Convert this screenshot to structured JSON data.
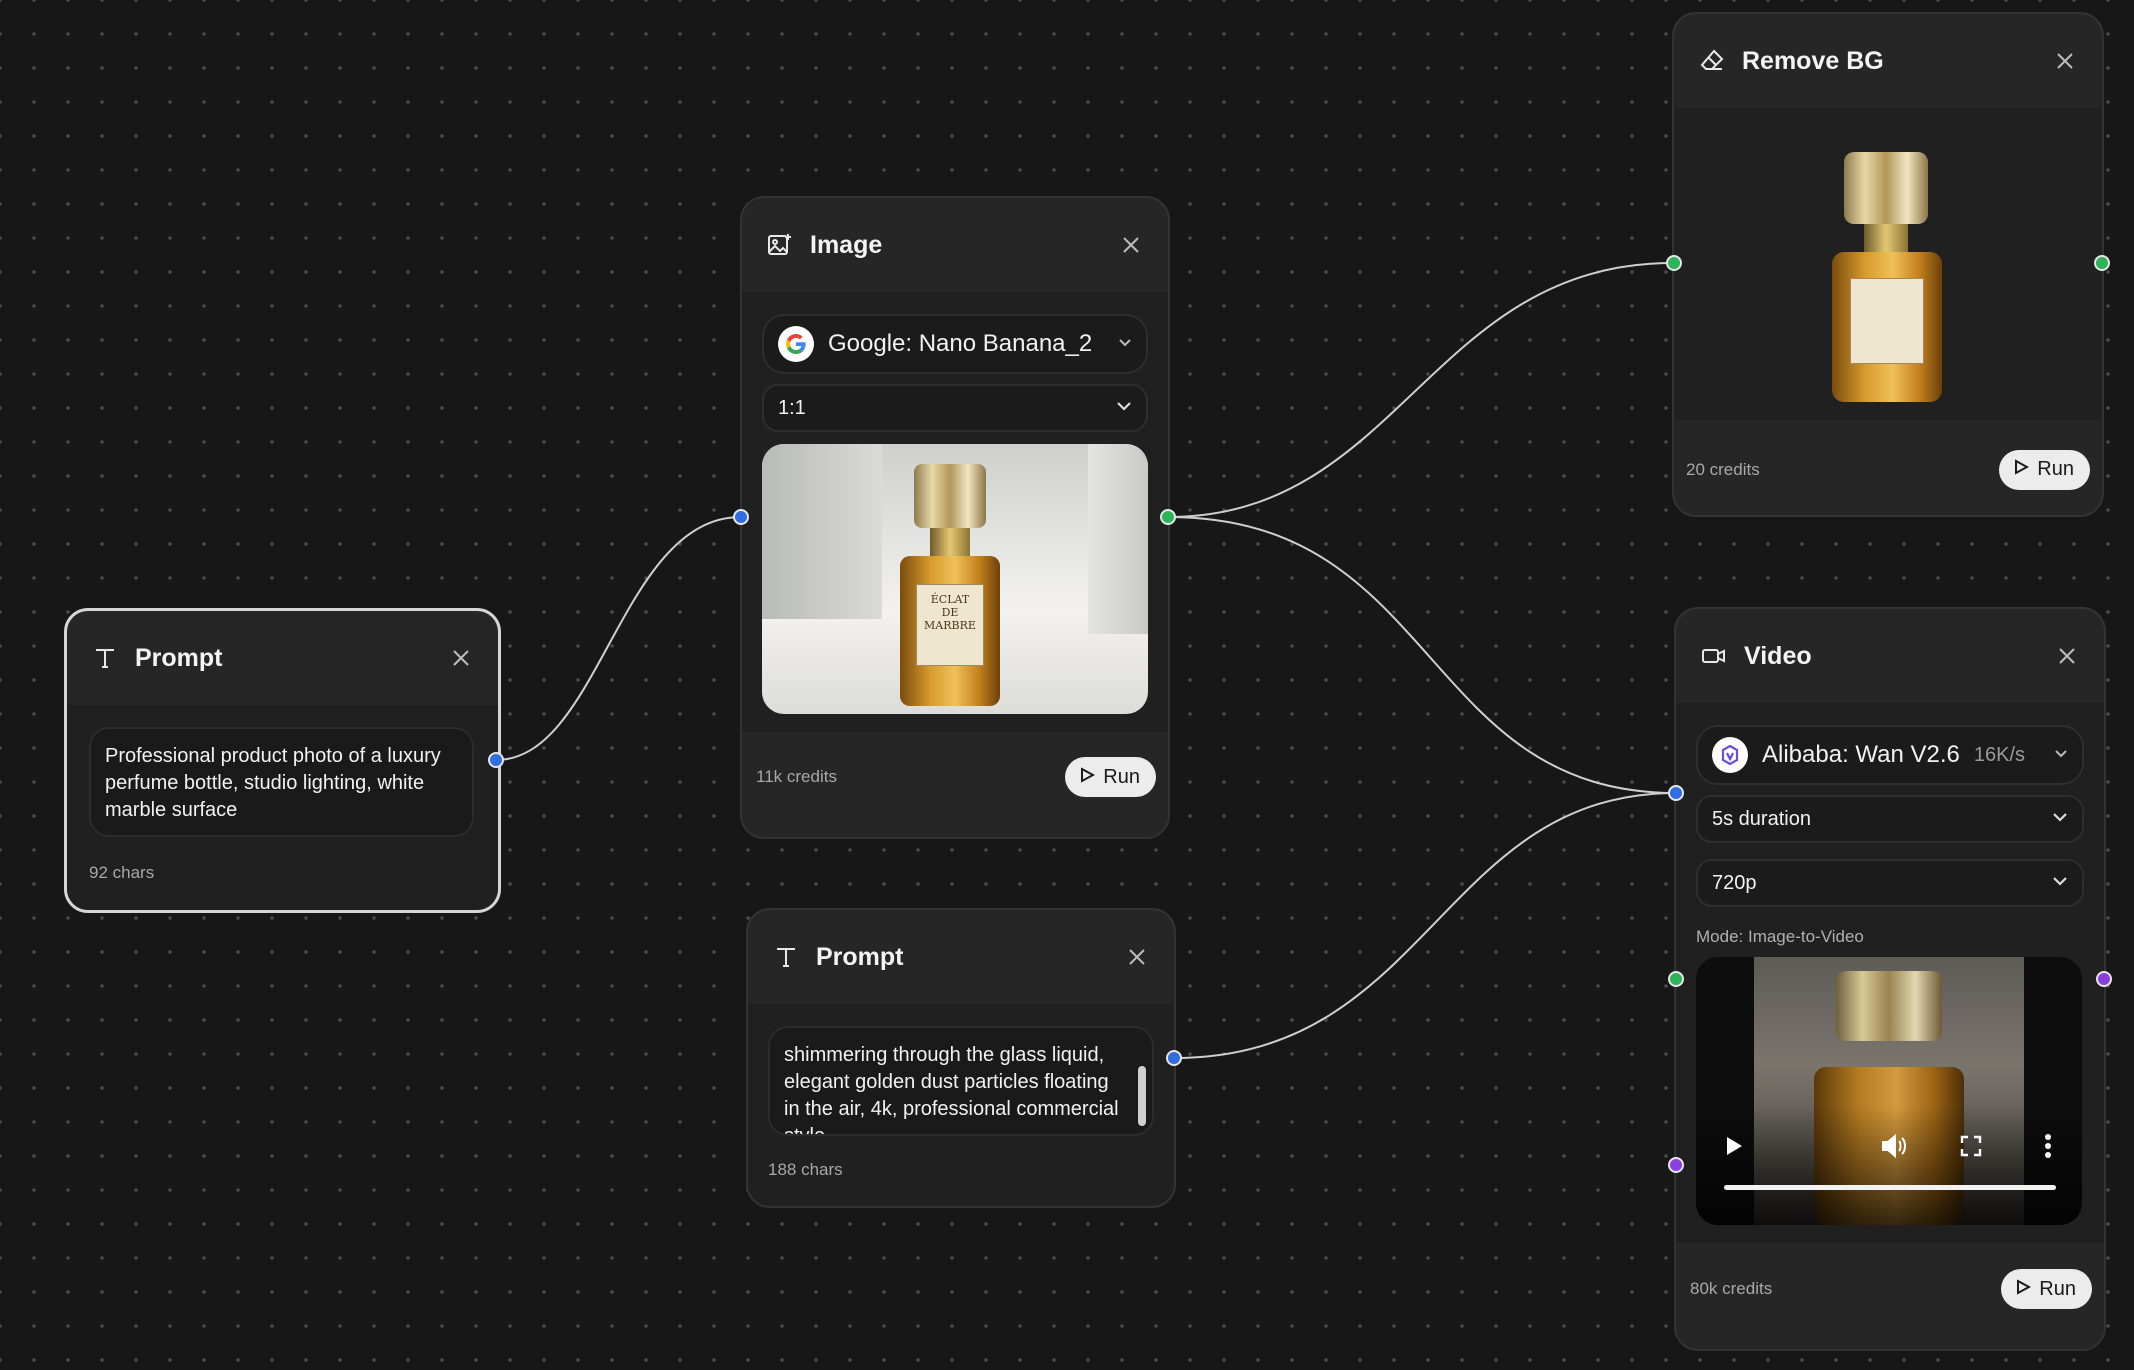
{
  "canvas": {
    "prompt_node_1": {
      "title": "Prompt",
      "text": "Professional product photo of a luxury perfume bottle, studio lighting, white marble surface",
      "chars": "92 chars"
    },
    "image_node": {
      "title": "Image",
      "model": "Google: Nano Banana_2",
      "aspect_ratio": "1:1",
      "credits": "11k credits",
      "run_label": "Run",
      "image_label": "ÉCLAT\nDE\nMARBRE"
    },
    "prompt_node_2": {
      "title": "Prompt",
      "text": "shimmering through the glass liquid, elegant golden dust particles floating in the air, 4k, professional commercial style",
      "chars": "188 chars"
    },
    "remove_bg_node": {
      "title": "Remove BG",
      "credits": "20 credits",
      "run_label": "Run"
    },
    "video_node": {
      "title": "Video",
      "model": "Alibaba: Wan V2.6",
      "model_price": "16K/s",
      "duration": "5s duration",
      "resolution": "720p",
      "mode": "Mode: Image-to-Video",
      "credits": "80k credits",
      "run_label": "Run",
      "progress": 1.0
    }
  },
  "colors": {
    "background": "#171717",
    "node": "#262626",
    "port_blue": "#2f6de0",
    "port_green": "#2fb35a",
    "port_purple": "#8a3fe0"
  }
}
